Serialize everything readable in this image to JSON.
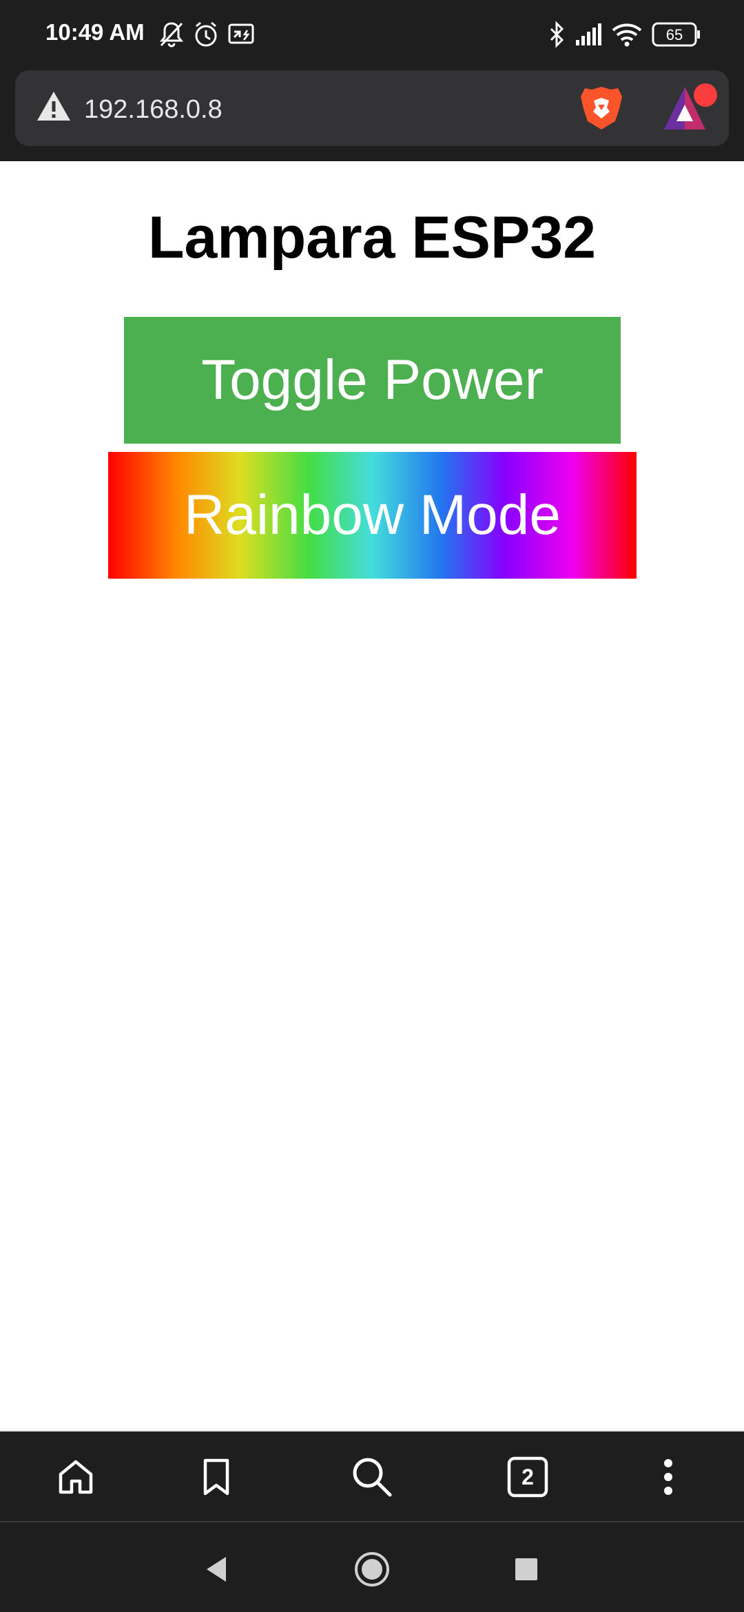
{
  "status_bar": {
    "time": "10:49 AM",
    "battery": "65",
    "icons": [
      "mute-icon",
      "alarm-icon",
      "screen-mirror-icon",
      "bluetooth-icon",
      "signal-icon",
      "wifi-icon",
      "battery-icon"
    ]
  },
  "browser": {
    "url": "192.168.0.8",
    "icons": [
      "warning-icon",
      "brave-shield-icon",
      "brave-rewards-icon"
    ]
  },
  "page": {
    "title": "Lampara ESP32",
    "buttons": {
      "toggle_power": "Toggle Power",
      "rainbow_mode": "Rainbow Mode"
    },
    "colors": {
      "toggle_bg": "#4caf50",
      "rainbow": [
        "#ff0000",
        "#ff8800",
        "#dddd22",
        "#44dd44",
        "#44dddd",
        "#2277ee",
        "#8800ff",
        "#ee00ee",
        "#ff0000"
      ]
    }
  },
  "bottom_nav": {
    "tab_count": "2",
    "icons": [
      "home-icon",
      "bookmark-icon",
      "search-icon",
      "tabs-icon",
      "menu-icon"
    ]
  },
  "system_nav": {
    "icons": [
      "back-icon",
      "home-circle-icon",
      "recents-icon"
    ]
  }
}
